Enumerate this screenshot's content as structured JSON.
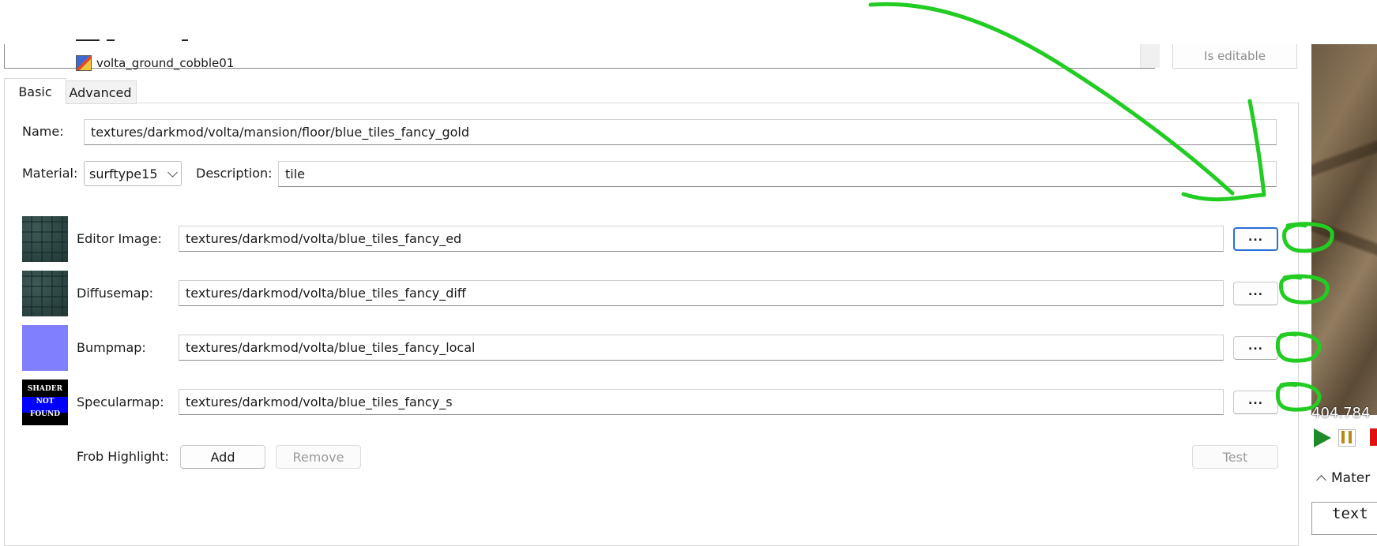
{
  "list": {
    "item_label": "volta_ground_cobble01"
  },
  "editable_button": "Is editable",
  "tabs": [
    {
      "label": "Basic",
      "selected": true
    },
    {
      "label": "Advanced",
      "selected": false
    }
  ],
  "form": {
    "name_label": "Name:",
    "name_value": "textures/darkmod/volta/mansion/floor/blue_tiles_fancy_gold",
    "material_label": "Material:",
    "material_value": "surftype15",
    "description_label": "Description:",
    "description_value": "tile"
  },
  "maps": [
    {
      "label": "Editor Image:",
      "value": "textures/darkmod/volta/blue_tiles_fancy_ed",
      "browse": "...",
      "thumb": "tile"
    },
    {
      "label": "Diffusemap:",
      "value": "textures/darkmod/volta/blue_tiles_fancy_diff",
      "browse": "...",
      "thumb": "tile"
    },
    {
      "label": "Bumpmap:",
      "value": "textures/darkmod/volta/blue_tiles_fancy_local",
      "browse": "...",
      "thumb": "bump"
    },
    {
      "label": "Specularmap:",
      "value": "textures/darkmod/volta/blue_tiles_fancy_s",
      "browse": "...",
      "thumb": "not-found"
    }
  ],
  "shader_not_found": [
    "SHADER",
    "NOT",
    "FOUND"
  ],
  "frob": {
    "label": "Frob Highlight:",
    "add": "Add",
    "remove": "Remove",
    "test": "Test"
  },
  "viewport": {
    "coord_text": "404.784",
    "section_label": "Mater",
    "code_text": "text"
  },
  "colors": {
    "annotation": "#22cc22",
    "focus": "#2a6fd6",
    "bumpmap": "#8080ff",
    "stop": "#e01010",
    "play": "#1e8a2a"
  }
}
